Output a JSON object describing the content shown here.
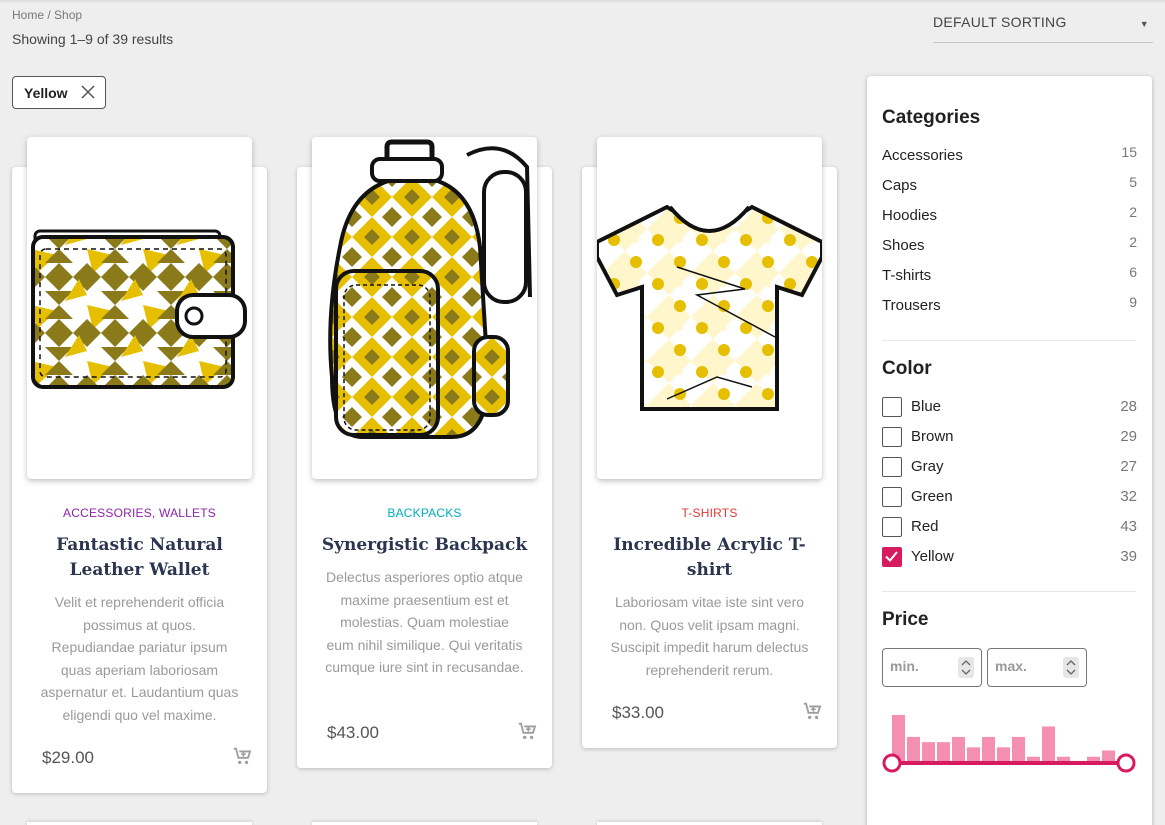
{
  "breadcrumb": "Home / Shop",
  "results_text": "Showing 1–9 of 39 results",
  "sort_label": "DEFAULT SORTING",
  "active_filter": "Yellow",
  "products": [
    {
      "category": "ACCESSORIES, WALLETS",
      "category_color": "#8e24aa",
      "title": "Fantastic Natural Leather Wallet",
      "description": "Velit et reprehenderit officia possimus at quos. Repudiandae pariatur ipsum quas aperiam laboriosam aspernatur et. Laudantium quas eligendi quo vel maxime.",
      "price": "$29.00",
      "image_icon": "wallet-icon"
    },
    {
      "category": "BACKPACKS",
      "category_color": "#00acc1",
      "title": "Synergistic Backpack",
      "description": "Delectus asperiores optio atque maxime praesentium est et molestias. Quam molestiae eum nihil similique. Qui veritatis cumque iure sint in recusandae.",
      "price": "$43.00",
      "image_icon": "backpack-icon"
    },
    {
      "category": "T-SHIRTS",
      "category_color": "#e53935",
      "title": "Incredible Acrylic T-shirt",
      "description": "Laboriosam vitae iste sint vero non. Quos velit ipsam magni. Suscipit impedit harum delectus reprehenderit rerum.",
      "price": "$33.00",
      "image_icon": "tshirt-icon"
    }
  ],
  "sidebar": {
    "categories_title": "Categories",
    "categories": [
      {
        "label": "Accessories",
        "count": "15"
      },
      {
        "label": "Caps",
        "count": "5"
      },
      {
        "label": "Hoodies",
        "count": "2"
      },
      {
        "label": "Shoes",
        "count": "2"
      },
      {
        "label": "T-shirts",
        "count": "6"
      },
      {
        "label": "Trousers",
        "count": "9"
      }
    ],
    "color_title": "Color",
    "colors": [
      {
        "label": "Blue",
        "count": "28",
        "checked": false
      },
      {
        "label": "Brown",
        "count": "29",
        "checked": false
      },
      {
        "label": "Gray",
        "count": "27",
        "checked": false
      },
      {
        "label": "Green",
        "count": "32",
        "checked": false
      },
      {
        "label": "Red",
        "count": "43",
        "checked": false
      },
      {
        "label": "Yellow",
        "count": "39",
        "checked": true
      }
    ],
    "price_title": "Price",
    "min_placeholder": "min.",
    "max_placeholder": "max.",
    "histogram": [
      46,
      25,
      20,
      20,
      25,
      15,
      25,
      15,
      25,
      6,
      35,
      6,
      2,
      6,
      12
    ],
    "accent_color": "#d81b60"
  },
  "colors": {
    "yellow": "#e6bf00",
    "olive": "#8b7a1a",
    "cream": "#fff6cc",
    "outline": "#111111"
  }
}
